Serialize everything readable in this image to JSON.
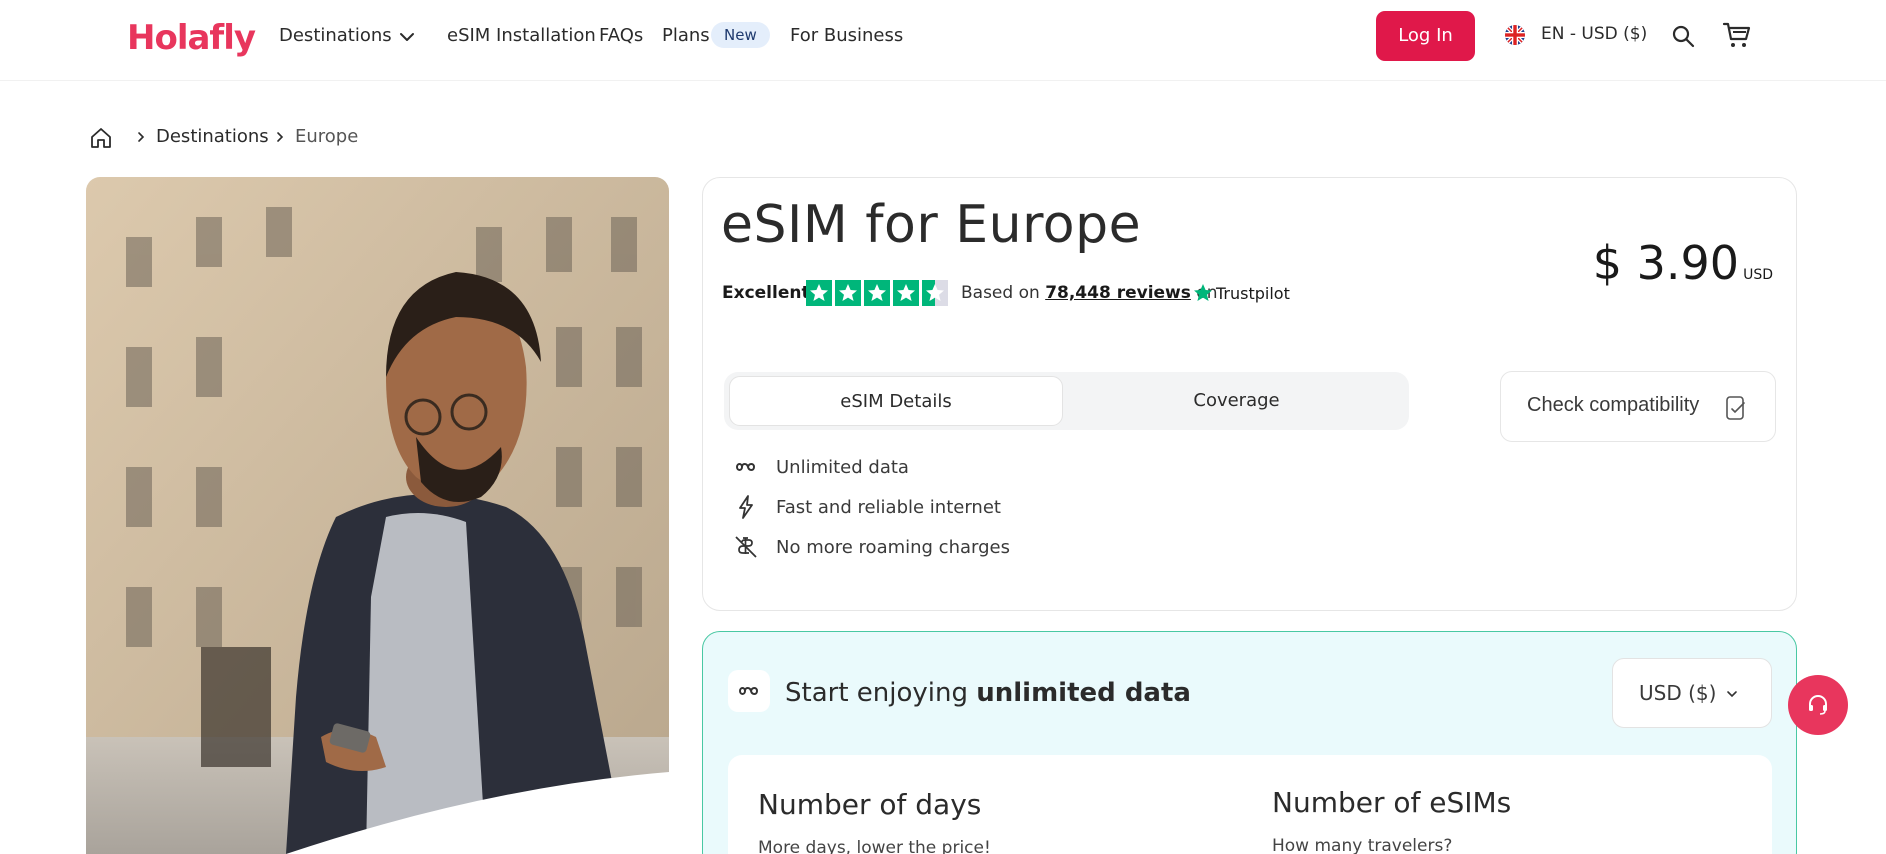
{
  "header": {
    "logo": "Holafly",
    "nav": {
      "destinations": "Destinations",
      "esim_installation": "eSIM Installation",
      "faqs": "FAQs",
      "plans": "Plans",
      "plans_badge": "New",
      "for_business": "For Business"
    },
    "login_label": "Log In",
    "locale": "EN - USD ($)"
  },
  "breadcrumb": {
    "items": [
      "Destinations",
      "Europe"
    ]
  },
  "product": {
    "title": "eSIM for Europe",
    "rating_word": "Excellent",
    "rating_stars": 4.5,
    "based_on_prefix": "Based on",
    "reviews_link": "78,448 reviews",
    "based_on_suffix": "on",
    "trustpilot": "Trustpilot",
    "price": "$ 3.90",
    "price_currency": "USD",
    "tabs": [
      "eSIM Details",
      "Coverage"
    ],
    "check_compat": "Check compatibility",
    "features": [
      {
        "icon": "infinity-icon",
        "label": "Unlimited data"
      },
      {
        "icon": "lightning-icon",
        "label": "Fast and reliable internet"
      },
      {
        "icon": "no-roaming-icon",
        "label": "No more roaming charges"
      }
    ]
  },
  "plan_selector": {
    "title_prefix": "Start enjoying",
    "title_bold": "unlimited data",
    "currency": "USD ($)",
    "days_title": "Number of days",
    "days_sub": "More days, lower the price!",
    "esims_title": "Number of eSIMs",
    "esims_sub": "How many travelers?"
  },
  "colors": {
    "brand": "#e8365d",
    "login": "#e0184a",
    "trustpilot_green": "#00b67a",
    "accent_border": "#49c8a3"
  }
}
